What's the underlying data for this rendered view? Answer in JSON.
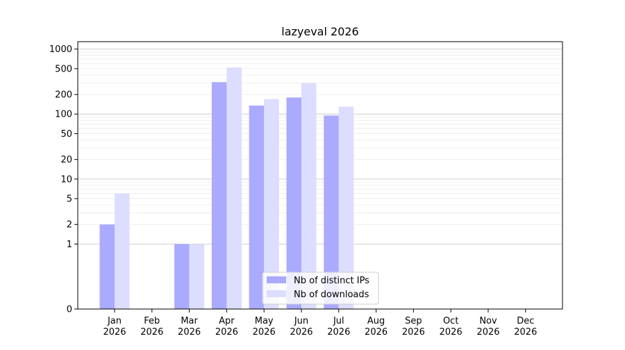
{
  "chart_data": {
    "type": "bar",
    "title": "lazyeval 2026",
    "xlabel": "",
    "ylabel": "",
    "yscale": "symlog",
    "ylim": [
      0,
      1300
    ],
    "yticks": [
      0,
      1,
      2,
      5,
      10,
      20,
      50,
      100,
      200,
      500,
      1000
    ],
    "grid": true,
    "legend_position": "lower center",
    "categories": [
      {
        "month": "Jan",
        "year": "2026"
      },
      {
        "month": "Feb",
        "year": "2026"
      },
      {
        "month": "Mar",
        "year": "2026"
      },
      {
        "month": "Apr",
        "year": "2026"
      },
      {
        "month": "May",
        "year": "2026"
      },
      {
        "month": "Jun",
        "year": "2026"
      },
      {
        "month": "Jul",
        "year": "2026"
      },
      {
        "month": "Aug",
        "year": "2026"
      },
      {
        "month": "Sep",
        "year": "2026"
      },
      {
        "month": "Oct",
        "year": "2026"
      },
      {
        "month": "Nov",
        "year": "2026"
      },
      {
        "month": "Dec",
        "year": "2026"
      }
    ],
    "series": [
      {
        "name": "Nb of distinct IPs",
        "color": "#aaaaff",
        "values": [
          2,
          0,
          1,
          310,
          135,
          180,
          95,
          0,
          0,
          0,
          0,
          0
        ]
      },
      {
        "name": "Nb of downloads",
        "color": "#ddddff",
        "values": [
          6,
          0,
          1,
          520,
          170,
          300,
          130,
          0,
          0,
          0,
          0,
          0
        ]
      }
    ]
  }
}
